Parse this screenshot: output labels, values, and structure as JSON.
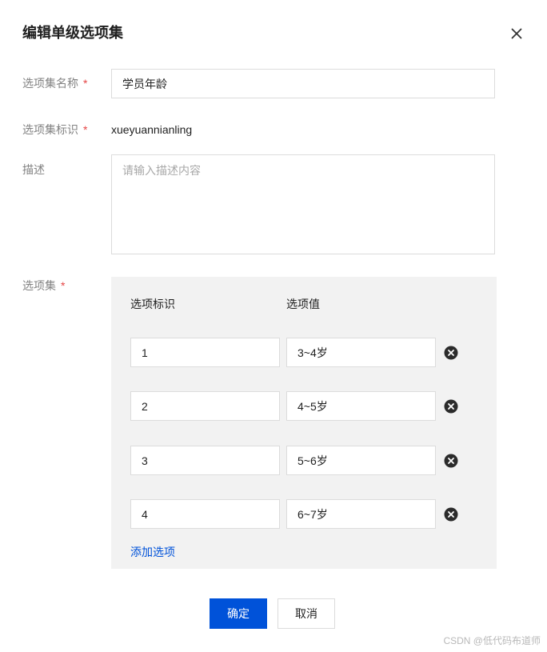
{
  "dialog": {
    "title": "编辑单级选项集",
    "close_icon": "close-icon"
  },
  "form": {
    "name": {
      "label": "选项集名称",
      "required_mark": "*",
      "value": "学员年龄"
    },
    "identifier": {
      "label": "选项集标识",
      "required_mark": "*",
      "value": "xueyuannianling"
    },
    "description": {
      "label": "描述",
      "placeholder": "请输入描述内容",
      "value": ""
    },
    "options": {
      "label": "选项集",
      "required_mark": "*",
      "col_id_header": "选项标识",
      "col_value_header": "选项值",
      "rows": [
        {
          "id": "1",
          "value": "3~4岁"
        },
        {
          "id": "2",
          "value": "4~5岁"
        },
        {
          "id": "3",
          "value": "5~6岁"
        },
        {
          "id": "4",
          "value": "6~7岁"
        }
      ],
      "remove_icon": "remove-circle-icon",
      "add_label": "添加选项"
    }
  },
  "footer": {
    "confirm_label": "确定",
    "cancel_label": "取消"
  },
  "watermark": "CSDN @低代码布道师",
  "colors": {
    "primary": "#0052d9",
    "required": "#e54545",
    "panel_bg": "#f2f2f2"
  }
}
